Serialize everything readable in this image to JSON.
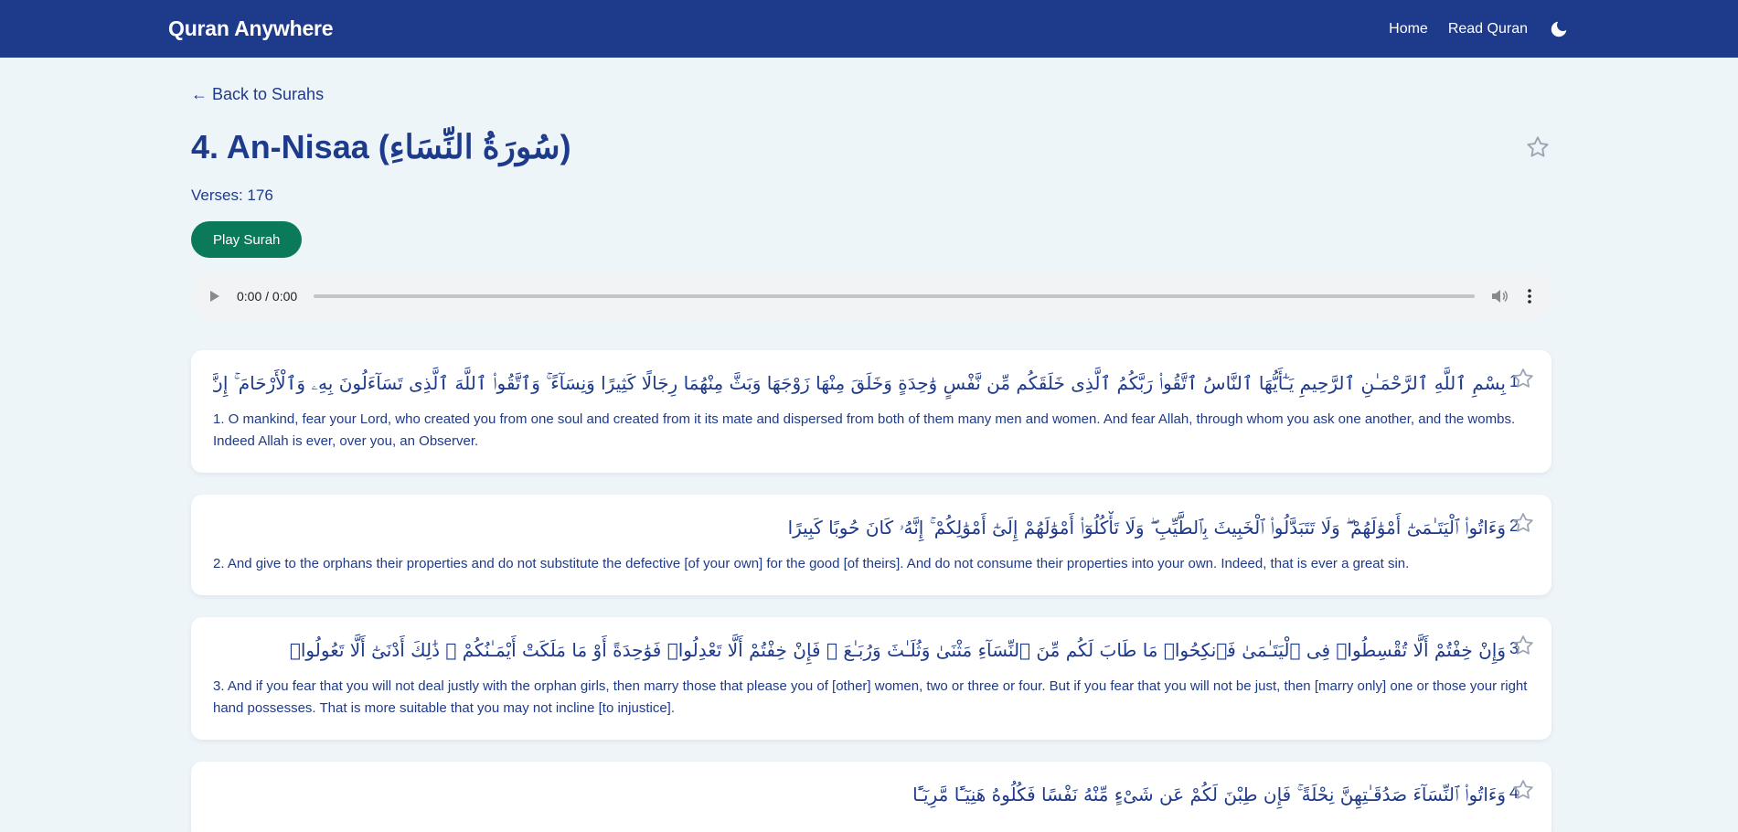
{
  "app": {
    "brand": "Quran Anywhere",
    "nav": {
      "home": "Home",
      "read": "Read Quran"
    }
  },
  "page": {
    "back_link": "← Back to Surahs",
    "title": "4. An-Nisaa (سُورَةُ النِّسَاءِ)",
    "verses_label": "Verses: 176",
    "play_label": "Play Surah",
    "audio_time": "0:00 / 0:00"
  },
  "verses": [
    {
      "number": "1",
      "arabic": "بِسْمِ ٱللَّهِ ٱلرَّحْمَـٰنِ ٱلرَّحِيمِ يَـٰٓأَيُّهَا ٱلنَّاسُ ٱتَّقُوا۟ رَبَّكُمُ ٱلَّذِى خَلَقَكُم مِّن نَّفْسٍ وَٰحِدَةٍ وَخَلَقَ مِنْهَا زَوْجَهَا وَبَثَّ مِنْهُمَا رِجَالًا كَثِيرًا وَنِسَآءً ۚ وَٱتَّقُوا۟ ٱللَّهَ ٱلَّذِى تَسَآءَلُونَ بِهِۦ وَٱلْأَرْحَامَ ۚ إِنَّ ٱللَّهَ كَانَ عَلَيْكُمْ رَقِيبًا",
      "translation": "1. O mankind, fear your Lord, who created you from one soul and created from it its mate and dispersed from both of them many men and women. And fear Allah, through whom you ask one another, and the wombs. Indeed Allah is ever, over you, an Observer."
    },
    {
      "number": "2",
      "arabic": "وَءَاتُوا۟ ٱلْيَتَـٰمَىٰٓ أَمْوَٰلَهُمْ ۖ وَلَا تَتَبَدَّلُوا۟ ٱلْخَبِيثَ بِٱلطَّيِّبِ ۖ وَلَا تَأْكُلُوٓا۟ أَمْوَٰلَهُمْ إِلَىٰٓ أَمْوَٰلِكُمْ ۚ إِنَّهُۥ كَانَ حُوبًا كَبِيرًا",
      "translation": "2. And give to the orphans their properties and do not substitute the defective [of your own] for the good [of theirs]. And do not consume their properties into your own. Indeed, that is ever a great sin."
    },
    {
      "number": "3",
      "arabic": "وَإِنْ خِفْتُمْ أَلَّا تُقْسِطُوا۟ فِى ٱلْيَتَـٰمَىٰ فَٱنكِحُوا۟ مَا طَابَ لَكُم مِّنَ ٱلنِّسَآءِ مَثْنَىٰ وَثُلَـٰثَ وَرُبَـٰعَ ۖ فَإِنْ خِفْتُمْ أَلَّا تَعْدِلُوا۟ فَوَٰحِدَةً أَوْ مَا مَلَكَتْ أَيْمَـٰنُكُمْ ۚ ذَٰلِكَ أَدْنَىٰٓ أَلَّا تَعُولُوا۟",
      "translation": "3. And if you fear that you will not deal justly with the orphan girls, then marry those that please you of [other] women, two or three or four. But if you fear that you will not be just, then [marry only] one or those your right hand possesses. That is more suitable that you may not incline [to injustice]."
    },
    {
      "number": "4",
      "arabic": "وَءَاتُوا۟ ٱلنِّسَآءَ صَدُقَـٰتِهِنَّ نِحْلَةً ۚ فَإِن طِبْنَ لَكُمْ عَن شَىْءٍ مِّنْهُ نَفْسًا فَكُلُوهُ هَنِيٓـًٔا مَّرِيٓـًٔا",
      "translation": ""
    }
  ]
}
